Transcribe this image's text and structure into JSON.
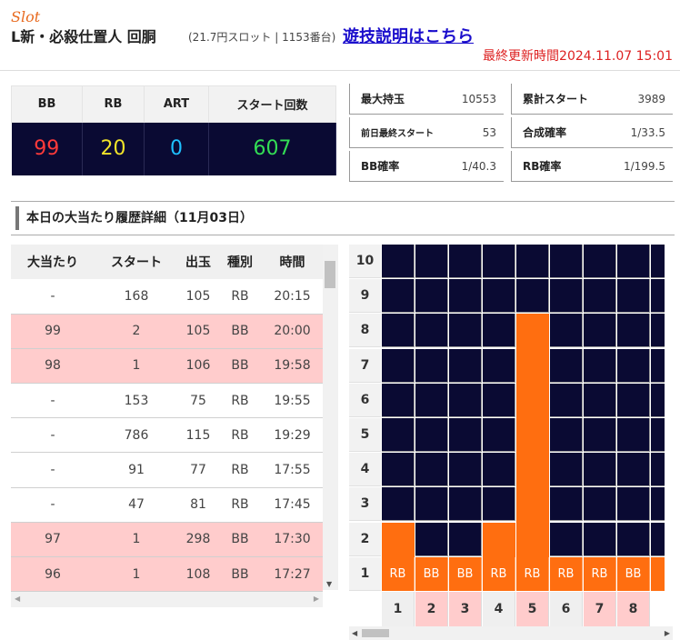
{
  "header": {
    "slot_tag": "Slot",
    "machine_name": "L新・必殺仕置人 回胴",
    "machine_sub": "(21.7円スロット | 1153番台)",
    "help_link": "遊技説明はこちら",
    "updated": "最終更新時間2024.11.07 15:01"
  },
  "counters": {
    "headers": [
      "BB",
      "RB",
      "ART",
      "スタート回数"
    ],
    "values": [
      "99",
      "20",
      "0",
      "607"
    ],
    "colors": [
      "#ff3a3a",
      "#f1e32a",
      "#1ec0ff",
      "#33dd55"
    ]
  },
  "stats": [
    {
      "label": "最大持玉",
      "value": "10553"
    },
    {
      "label": "累計スタート",
      "value": "3989"
    },
    {
      "label": "前日最終スタート",
      "value": "53"
    },
    {
      "label": "合成確率",
      "value": "1/33.5"
    },
    {
      "label": "BB確率",
      "value": "1/40.3"
    },
    {
      "label": "RB確率",
      "value": "1/199.5"
    }
  ],
  "section": {
    "title": "本日の大当たり履歴詳細（11月03日）"
  },
  "history": {
    "columns": [
      "大当たり",
      "スタート",
      "出玉",
      "種別",
      "時間"
    ],
    "rows": [
      {
        "hit": "-",
        "start": "168",
        "out": "105",
        "type": "RB",
        "time": "20:15",
        "highlight": false
      },
      {
        "hit": "99",
        "start": "2",
        "out": "105",
        "type": "BB",
        "time": "20:00",
        "highlight": true
      },
      {
        "hit": "98",
        "start": "1",
        "out": "106",
        "type": "BB",
        "time": "19:58",
        "highlight": true
      },
      {
        "hit": "-",
        "start": "153",
        "out": "75",
        "type": "RB",
        "time": "19:55",
        "highlight": false
      },
      {
        "hit": "-",
        "start": "786",
        "out": "115",
        "type": "RB",
        "time": "19:29",
        "highlight": false
      },
      {
        "hit": "-",
        "start": "91",
        "out": "77",
        "type": "RB",
        "time": "17:55",
        "highlight": false
      },
      {
        "hit": "-",
        "start": "47",
        "out": "81",
        "type": "RB",
        "time": "17:45",
        "highlight": false
      },
      {
        "hit": "97",
        "start": "1",
        "out": "298",
        "type": "BB",
        "time": "17:30",
        "highlight": true
      },
      {
        "hit": "96",
        "start": "1",
        "out": "108",
        "type": "BB",
        "time": "17:27",
        "highlight": true
      }
    ]
  },
  "graph": {
    "y_labels": [
      "10",
      "9",
      "8",
      "7",
      "6",
      "5",
      "4",
      "3",
      "2",
      "1"
    ],
    "x_labels": [
      "1",
      "2",
      "3",
      "4",
      "5",
      "6",
      "7",
      "8"
    ],
    "x_highlight": [
      false,
      true,
      true,
      false,
      true,
      false,
      true,
      true
    ],
    "types": [
      "RB",
      "BB",
      "BB",
      "RB",
      "RB",
      "RB",
      "RB",
      "BB"
    ],
    "levels": [
      2,
      1,
      1,
      2,
      8,
      1,
      1,
      1
    ],
    "bar_color": "#ff6e10",
    "grid_color": "#0a0a33"
  }
}
